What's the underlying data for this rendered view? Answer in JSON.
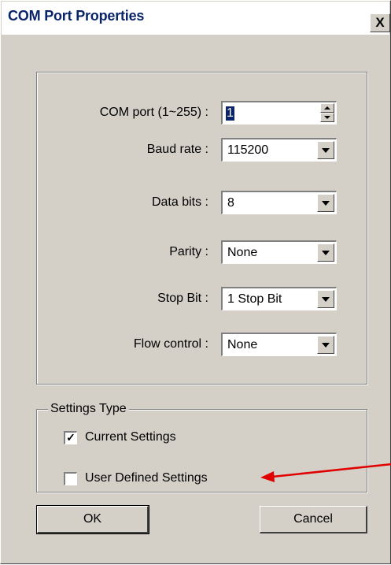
{
  "window": {
    "title": "COM Port Properties",
    "close_glyph": "X"
  },
  "fields": [
    {
      "label": "COM port (1~255) :",
      "value": "1",
      "control": "spinner"
    },
    {
      "label": "Baud rate :",
      "value": "115200",
      "control": "dropdown"
    },
    {
      "label": "Data bits :",
      "value": "8",
      "control": "dropdown"
    },
    {
      "label": "Parity :",
      "value": "None",
      "control": "dropdown"
    },
    {
      "label": "Stop Bit :",
      "value": "1 Stop Bit",
      "control": "dropdown"
    },
    {
      "label": "Flow control :",
      "value": "None",
      "control": "dropdown"
    }
  ],
  "settings_type": {
    "legend": "Settings Type",
    "options": [
      {
        "label": "Current Settings",
        "checked": true
      },
      {
        "label": "User Defined Settings",
        "checked": false
      }
    ]
  },
  "buttons": {
    "ok": "OK",
    "cancel": "Cancel"
  },
  "annotation": {
    "arrow_color": "#e00000"
  },
  "colors": {
    "dialog_bg": "#d4d0c8",
    "title_text": "#0a246a"
  }
}
